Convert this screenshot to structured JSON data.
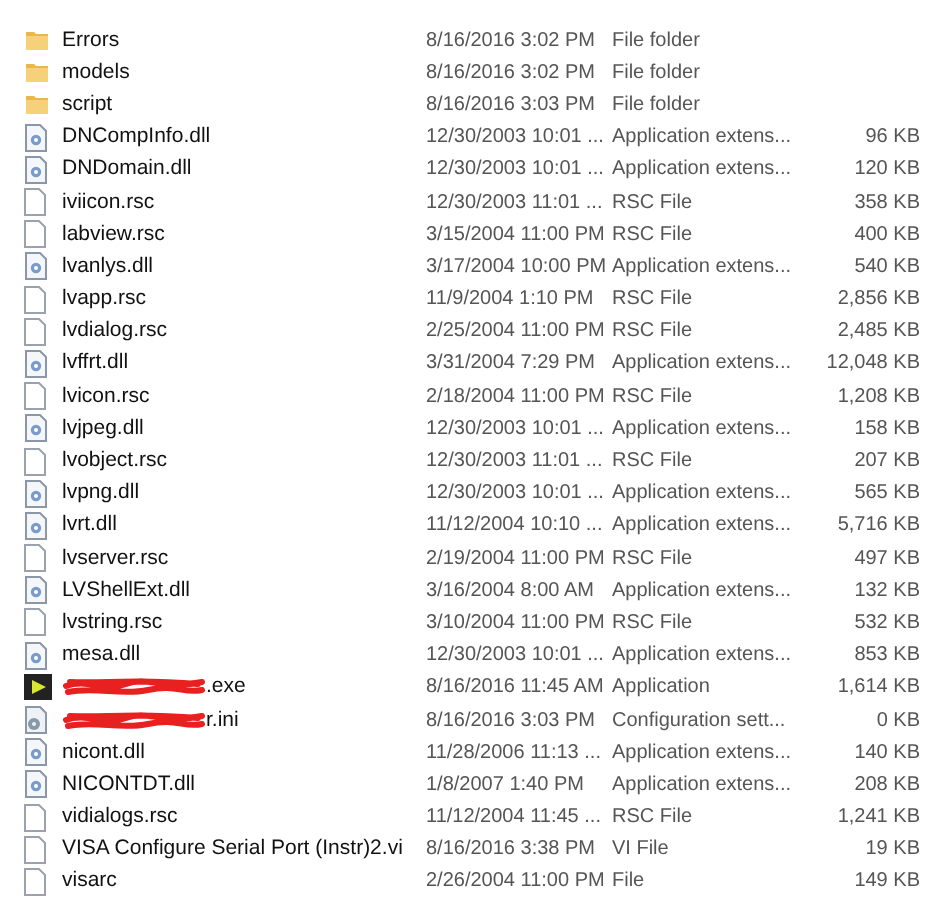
{
  "files": [
    {
      "kind": "folder",
      "name": "Errors",
      "date": "8/16/2016 3:02 PM",
      "type": "File folder"
    },
    {
      "kind": "folder",
      "name": "models",
      "date": "8/16/2016 3:02 PM",
      "type": "File folder"
    },
    {
      "kind": "folder",
      "name": "script",
      "date": "8/16/2016 3:03 PM",
      "type": "File folder"
    },
    {
      "kind": "dll",
      "name": "DNCompInfo.dll",
      "date": "12/30/2003 10:01 ...",
      "type": "Application extens...",
      "size": "96 KB"
    },
    {
      "kind": "dll",
      "name": "DNDomain.dll",
      "date": "12/30/2003 10:01 ...",
      "type": "Application extens...",
      "size": "120 KB"
    },
    {
      "kind": "file",
      "name": "iviicon.rsc",
      "date": "12/30/2003 11:01 ...",
      "type": "RSC File",
      "size": "358 KB"
    },
    {
      "kind": "file",
      "name": "labview.rsc",
      "date": "3/15/2004 11:00 PM",
      "type": "RSC File",
      "size": "400 KB"
    },
    {
      "kind": "dll",
      "name": "lvanlys.dll",
      "date": "3/17/2004 10:00 PM",
      "type": "Application extens...",
      "size": "540 KB"
    },
    {
      "kind": "file",
      "name": "lvapp.rsc",
      "date": "11/9/2004 1:10 PM",
      "type": "RSC File",
      "size": "2,856 KB"
    },
    {
      "kind": "file",
      "name": "lvdialog.rsc",
      "date": "2/25/2004 11:00 PM",
      "type": "RSC File",
      "size": "2,485 KB"
    },
    {
      "kind": "dll",
      "name": "lvffrt.dll",
      "date": "3/31/2004 7:29 PM",
      "type": "Application extens...",
      "size": "12,048 KB"
    },
    {
      "kind": "file",
      "name": "lvicon.rsc",
      "date": "2/18/2004 11:00 PM",
      "type": "RSC File",
      "size": "1,208 KB"
    },
    {
      "kind": "dll",
      "name": "lvjpeg.dll",
      "date": "12/30/2003 10:01 ...",
      "type": "Application extens...",
      "size": "158 KB"
    },
    {
      "kind": "file",
      "name": "lvobject.rsc",
      "date": "12/30/2003 11:01 ...",
      "type": "RSC File",
      "size": "207 KB"
    },
    {
      "kind": "dll",
      "name": "lvpng.dll",
      "date": "12/30/2003 10:01 ...",
      "type": "Application extens...",
      "size": "565 KB"
    },
    {
      "kind": "dll",
      "name": "lvrt.dll",
      "date": "11/12/2004 10:10 ...",
      "type": "Application extens...",
      "size": "5,716 KB"
    },
    {
      "kind": "file",
      "name": "lvserver.rsc",
      "date": "2/19/2004 11:00 PM",
      "type": "RSC File",
      "size": "497 KB"
    },
    {
      "kind": "dll",
      "name": "LVShellExt.dll",
      "date": "3/16/2004 8:00 AM",
      "type": "Application extens...",
      "size": "132 KB"
    },
    {
      "kind": "file",
      "name": "lvstring.rsc",
      "date": "3/10/2004 11:00 PM",
      "type": "RSC File",
      "size": "532 KB"
    },
    {
      "kind": "dll",
      "name": "mesa.dll",
      "date": "12/30/2003 10:01 ...",
      "type": "Application extens...",
      "size": "853 KB"
    },
    {
      "kind": "app",
      "name": ".exe",
      "redacted": true,
      "date": "8/16/2016 11:45 AM",
      "type": "Application",
      "size": "1,614 KB"
    },
    {
      "kind": "config",
      "name": "r.ini",
      "redacted": true,
      "date": "8/16/2016 3:03 PM",
      "type": "Configuration sett...",
      "size": "0 KB"
    },
    {
      "kind": "dll",
      "name": "nicont.dll",
      "date": "11/28/2006 11:13 ...",
      "type": "Application extens...",
      "size": "140 KB"
    },
    {
      "kind": "dll",
      "name": "NICONTDT.dll",
      "date": "1/8/2007 1:40 PM",
      "type": "Application extens...",
      "size": "208 KB"
    },
    {
      "kind": "file",
      "name": "vidialogs.rsc",
      "date": "11/12/2004 11:45 ...",
      "type": "RSC File",
      "size": "1,241 KB"
    },
    {
      "kind": "file",
      "name": "VISA Configure Serial Port (Instr)2.vi",
      "date": "8/16/2016 3:38 PM",
      "type": "VI File",
      "size": "19 KB"
    },
    {
      "kind": "file",
      "name": "visarc",
      "date": "2/26/2004 11:00 PM",
      "type": "File",
      "size": "149 KB"
    }
  ]
}
